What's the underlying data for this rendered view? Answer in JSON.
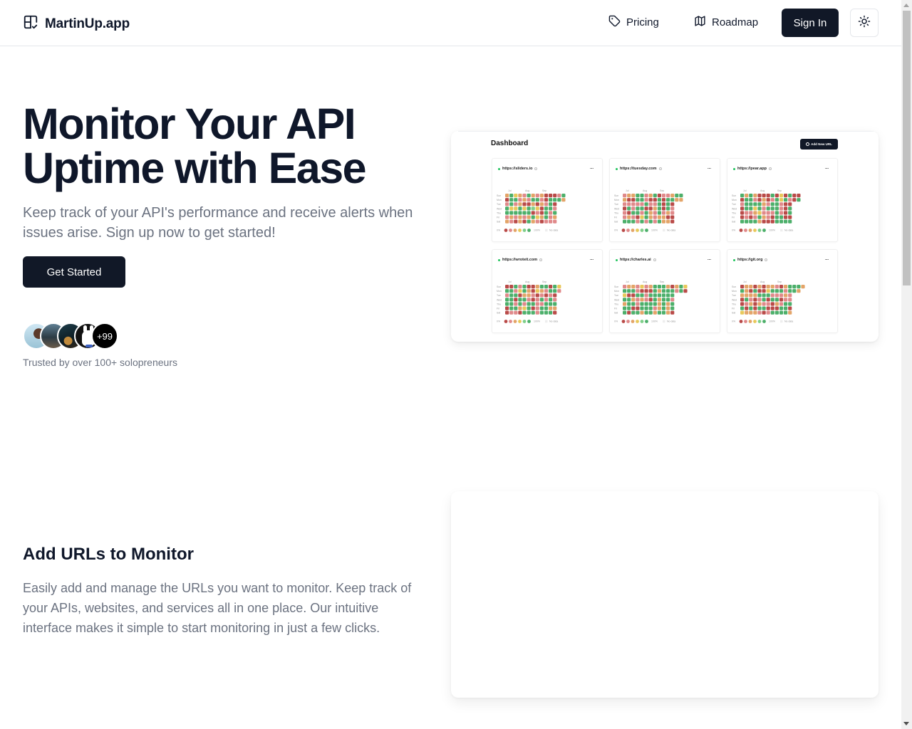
{
  "header": {
    "brand": "MartinUp.app",
    "nav": [
      {
        "label": "Pricing",
        "icon": "tag-icon"
      },
      {
        "label": "Roadmap",
        "icon": "map-icon"
      }
    ],
    "signin_label": "Sign In",
    "theme_toggle_icon": "sun-icon"
  },
  "hero": {
    "title_line1": "Monitor Your API",
    "title_line2": "Uptime with Ease",
    "subtitle": "Keep track of your API's performance and receive alerts when issues arise. Sign up now to get started!",
    "cta_label": "Get Started",
    "avatars_more": "+99",
    "trusted_text": "Trusted by over 100+ solopreneurs"
  },
  "preview": {
    "title": "Dashboard",
    "add_button": "Add New URL",
    "month_labels": [
      "Jul",
      "Aug",
      "Sep"
    ],
    "day_labels": [
      "Sun",
      "Mon",
      "Tue",
      "Wed",
      "Thu",
      "Fri",
      "Sat"
    ],
    "legend": {
      "min": "0%",
      "max": "100%",
      "nodata": "No data"
    },
    "level_colors": [
      "#b94a48",
      "#e0898a",
      "#e3a468",
      "#e8c85a",
      "#7fcf8a",
      "#4caf6a"
    ],
    "monitors": [
      {
        "url": "https://sliders.io",
        "menu": "...",
        "grid": [
          [
            2,
            5,
            3,
            2,
            1,
            5,
            2,
            1,
            2,
            0,
            0,
            0,
            1,
            5
          ],
          [
            0,
            5,
            5,
            1,
            2,
            1,
            5,
            5,
            1,
            0,
            5,
            5,
            5,
            2
          ],
          [
            1,
            5,
            1,
            2,
            0,
            0,
            2,
            0,
            2,
            1,
            5,
            0
          ],
          [
            5,
            3,
            3,
            5,
            3,
            5,
            4,
            3,
            0,
            5,
            5,
            1
          ],
          [
            5,
            5,
            5,
            5,
            5,
            5,
            0,
            1,
            0,
            5,
            1,
            5
          ],
          [
            1,
            2,
            1,
            2,
            1,
            2,
            5,
            3,
            2,
            5,
            1,
            2
          ],
          [
            2,
            1,
            0,
            2,
            0,
            5,
            2,
            1,
            0,
            1,
            1,
            1
          ]
        ]
      },
      {
        "url": "https://tuesday.com",
        "menu": "...",
        "grid": [
          [
            1,
            2,
            2,
            5,
            5,
            1,
            2,
            5,
            0,
            1,
            1,
            2,
            5,
            5
          ],
          [
            2,
            0,
            0,
            5,
            5,
            1,
            0,
            0,
            5,
            0,
            5,
            5,
            2,
            2
          ],
          [
            1,
            1,
            1,
            1,
            1,
            5,
            1,
            1,
            5,
            0,
            5,
            0
          ],
          [
            0,
            5,
            1,
            5,
            5,
            0,
            0,
            2,
            5,
            0,
            5,
            1
          ],
          [
            1,
            0,
            5,
            5,
            1,
            5,
            2,
            1,
            5,
            1,
            2,
            1
          ],
          [
            1,
            2,
            1,
            0,
            3,
            5,
            2,
            1,
            2,
            2,
            0,
            0
          ],
          [
            5,
            5,
            5,
            1,
            5,
            1,
            5,
            1,
            5,
            2,
            2,
            0
          ]
        ]
      },
      {
        "url": "https://pear.app",
        "menu": "...",
        "grid": [
          [
            5,
            2,
            5,
            2,
            0,
            0,
            0,
            5,
            0,
            3,
            0,
            5,
            0,
            0
          ],
          [
            0,
            5,
            5,
            1,
            0,
            2,
            0,
            1,
            5,
            3,
            5,
            1,
            0,
            5
          ],
          [
            1,
            5,
            5,
            5,
            5,
            2,
            1,
            5,
            5,
            1,
            0,
            0
          ],
          [
            0,
            5,
            5,
            3,
            5,
            1,
            5,
            5,
            5,
            1,
            0,
            5
          ],
          [
            0,
            1,
            1,
            2,
            3,
            1,
            1,
            1,
            5,
            1,
            0,
            5
          ],
          [
            0,
            1,
            0,
            1,
            5,
            2,
            1,
            0,
            5,
            5,
            0,
            0
          ],
          [
            5,
            5,
            5,
            5,
            2,
            0,
            0,
            0,
            5,
            5,
            5,
            5
          ]
        ]
      },
      {
        "url": "https://wroteit.com",
        "menu": "...",
        "grid": [
          [
            0,
            0,
            5,
            1,
            5,
            0,
            0,
            2,
            5,
            5,
            0,
            5,
            3
          ],
          [
            5,
            5,
            1,
            3,
            5,
            2,
            0,
            3,
            2,
            1,
            5,
            5,
            1
          ],
          [
            1,
            5,
            5,
            0,
            2,
            2,
            1,
            0,
            1,
            0,
            1,
            0
          ],
          [
            5,
            5,
            0,
            5,
            5,
            1,
            0,
            1,
            5,
            1,
            5,
            1
          ],
          [
            5,
            5,
            1,
            5,
            1,
            5,
            5,
            1,
            1,
            5,
            5,
            5
          ],
          [
            0,
            5,
            5,
            2,
            3,
            5,
            0,
            1,
            5,
            5,
            2,
            2
          ],
          [
            0,
            1,
            1,
            0,
            5,
            5,
            5,
            1,
            5,
            5,
            5,
            0
          ]
        ]
      },
      {
        "url": "https://charles.ai",
        "menu": "...",
        "grid": [
          [
            1,
            2,
            2,
            1,
            3,
            1,
            2,
            5,
            5,
            5,
            2,
            0,
            2,
            5,
            3
          ],
          [
            5,
            5,
            5,
            1,
            0,
            0,
            0,
            5,
            2,
            5,
            5,
            5,
            1,
            5,
            0
          ],
          [
            3,
            0,
            0,
            5,
            5,
            1,
            5,
            5,
            5,
            5,
            5,
            5
          ],
          [
            5,
            5,
            2,
            1,
            2,
            1,
            0,
            5,
            2,
            5,
            5,
            1
          ],
          [
            2,
            5,
            5,
            1,
            5,
            5,
            5,
            5,
            2,
            5,
            2,
            5
          ],
          [
            5,
            5,
            0,
            0,
            5,
            5,
            5,
            1,
            2,
            5,
            2,
            5
          ],
          [
            5,
            0,
            5,
            5,
            2,
            5,
            5,
            2,
            5,
            5,
            2,
            0
          ]
        ]
      },
      {
        "url": "https://git.org",
        "menu": "...",
        "grid": [
          [
            0,
            2,
            2,
            0,
            2,
            0,
            2,
            2,
            1,
            0,
            2,
            5,
            5,
            5,
            2
          ],
          [
            5,
            2,
            0,
            5,
            0,
            0,
            3,
            5,
            5,
            5,
            1,
            5,
            5,
            2
          ],
          [
            2,
            2,
            2,
            2,
            5,
            5,
            5,
            1,
            1,
            1,
            2,
            1
          ],
          [
            0,
            5,
            1,
            0,
            1,
            5,
            0,
            5,
            5,
            0,
            1,
            1
          ],
          [
            0,
            1,
            2,
            0,
            2,
            1,
            1,
            0,
            2,
            1,
            5,
            5
          ],
          [
            5,
            0,
            5,
            0,
            5,
            5,
            0,
            0,
            0,
            5,
            5,
            0
          ],
          [
            3,
            2,
            2,
            2,
            1,
            0,
            1,
            5,
            5,
            5,
            5,
            2
          ]
        ]
      }
    ]
  },
  "feature": {
    "title": "Add URLs to Monitor",
    "text": "Easily add and manage the URLs you want to monitor. Keep track of your APIs, websites, and services all in one place. Our intuitive interface makes it simple to start monitoring in just a few clicks."
  }
}
